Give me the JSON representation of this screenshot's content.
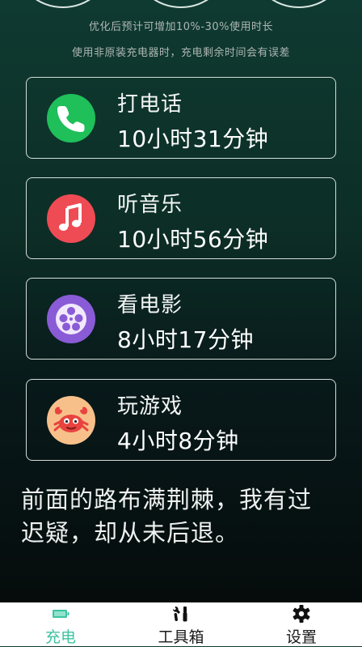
{
  "header": {
    "tips": [
      "优化后预计可增加10%-30%使用时长",
      "使用非原装充电器时，充电剩余时间会有误差"
    ]
  },
  "usage_cards": [
    {
      "title": "打电话",
      "value": "10小时31分钟",
      "icon": "phone-icon",
      "color": "#1fbf5a"
    },
    {
      "title": "听音乐",
      "value": "10小时56分钟",
      "icon": "music-note-icon",
      "color": "#ef4b55"
    },
    {
      "title": "看电影",
      "value": "8小时17分钟",
      "icon": "film-reel-icon",
      "color": "#8a5bd6"
    },
    {
      "title": "玩游戏",
      "value": "4小时8分钟",
      "icon": "crab-game-icon",
      "color": "#f7c08a"
    }
  ],
  "quote": "前面的路布满荆棘，我有过迟疑，却从未后退。",
  "tabbar": {
    "active_color": "#3ec3a1",
    "tabs": [
      {
        "label": "充电",
        "icon": "battery-icon",
        "active": true
      },
      {
        "label": "工具箱",
        "icon": "tools-icon",
        "active": false
      },
      {
        "label": "设置",
        "icon": "gear-icon",
        "active": false
      }
    ]
  }
}
